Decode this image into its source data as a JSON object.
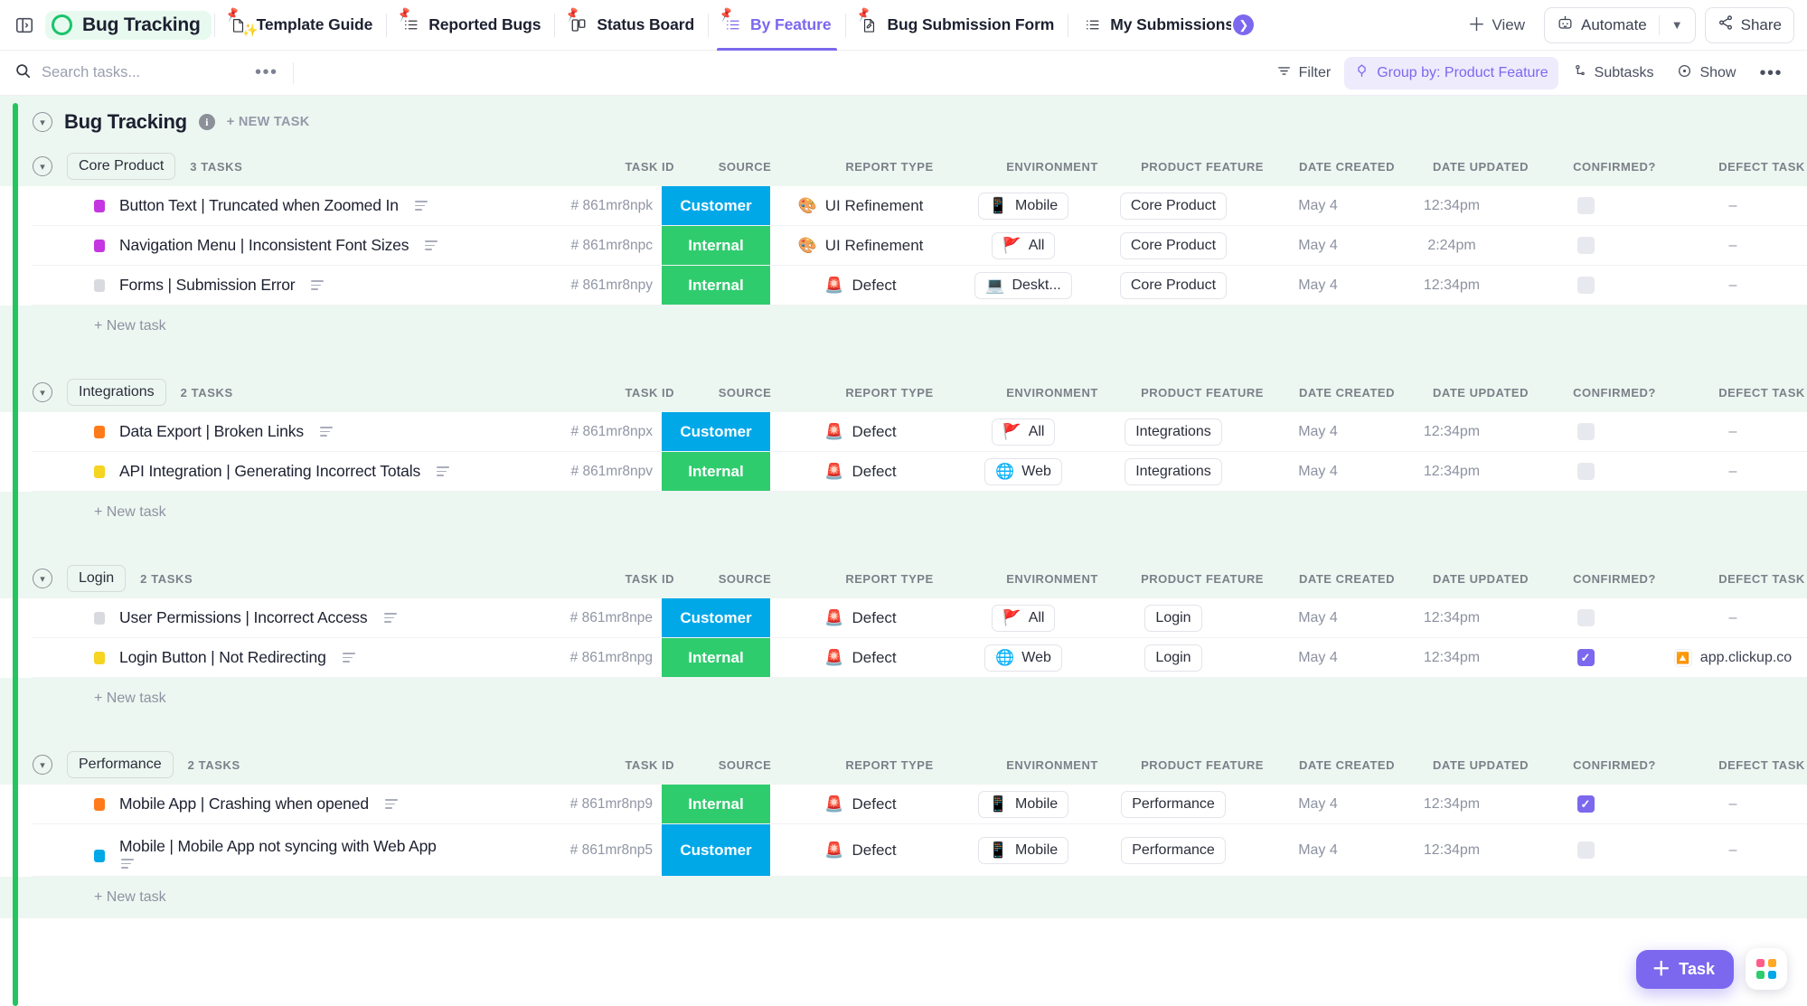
{
  "topnav": {
    "sidebar_toggle_icon": "panel-toggle-icon",
    "list_name": "Bug Tracking",
    "tabs": [
      {
        "label": "Template Guide",
        "icon": "doc-sparkle-icon",
        "active": false,
        "pinned": true,
        "truncated": false
      },
      {
        "label": "Reported Bugs",
        "icon": "list-icon",
        "active": false,
        "pinned": true,
        "truncated": false
      },
      {
        "label": "Status Board",
        "icon": "board-icon",
        "active": false,
        "pinned": true,
        "truncated": false
      },
      {
        "label": "By Feature",
        "icon": "list-icon",
        "active": true,
        "pinned": true,
        "truncated": false
      },
      {
        "label": "Bug Submission Form",
        "icon": "form-icon",
        "active": false,
        "pinned": true,
        "truncated": false
      },
      {
        "label": "My Submissions",
        "icon": "list-icon",
        "active": false,
        "pinned": false,
        "truncated": true
      }
    ],
    "view_button": "View",
    "automate_button": "Automate",
    "share_button": "Share"
  },
  "toolbar": {
    "search_placeholder": "Search tasks...",
    "search_value": "",
    "more_icon": "ellipsis-icon",
    "filter_label": "Filter",
    "group_by_label": "Group by: Product Feature",
    "subtasks_label": "Subtasks",
    "show_label": "Show",
    "overflow_icon": "ellipsis-icon"
  },
  "list_header": {
    "title": "Bug Tracking",
    "info_icon": "info-icon",
    "new_task_label": "+ NEW TASK",
    "accent_color": "#22c55e"
  },
  "columns": [
    "TASK ID",
    "SOURCE",
    "REPORT TYPE",
    "ENVIRONMENT",
    "PRODUCT FEATURE",
    "DATE CREATED",
    "DATE UPDATED",
    "CONFIRMED?",
    "DEFECT TASK"
  ],
  "new_task_row_label": "+ New task",
  "colors": {
    "source_customer": "#00a8e8",
    "source_internal": "#2fcc6e",
    "accent_purple": "#7b68ee",
    "group_band": "#edf7f1"
  },
  "groups": [
    {
      "name": "Core Product",
      "count_label": "3 TASKS",
      "tasks": [
        {
          "status_color": "#c436e0",
          "title": "Button Text | Truncated when Zoomed In",
          "has_description": true,
          "task_id": "# 861mr8npk",
          "source": "Customer",
          "source_type": "customer",
          "report_type": "UI Refinement",
          "report_emoji": "🎨",
          "environment": "Mobile",
          "env_emoji": "📱",
          "product_feature": "Core Product",
          "date_created": "May 4",
          "date_updated": "12:34pm",
          "confirmed": false,
          "defect_task": "–",
          "defect_link": null,
          "tall": false
        },
        {
          "status_color": "#c436e0",
          "title": "Navigation Menu | Inconsistent Font Sizes",
          "has_description": true,
          "task_id": "# 861mr8npc",
          "source": "Internal",
          "source_type": "internal",
          "report_type": "UI Refinement",
          "report_emoji": "🎨",
          "environment": "All",
          "env_emoji": "🚩",
          "product_feature": "Core Product",
          "date_created": "May 4",
          "date_updated": "2:24pm",
          "confirmed": false,
          "defect_task": "–",
          "defect_link": null,
          "tall": false
        },
        {
          "status_color": "#d8dadf",
          "title": "Forms | Submission Error",
          "has_description": true,
          "task_id": "# 861mr8npy",
          "source": "Internal",
          "source_type": "internal",
          "report_type": "Defect",
          "report_emoji": "🚨",
          "environment": "Deskt...",
          "env_emoji": "💻",
          "product_feature": "Core Product",
          "date_created": "May 4",
          "date_updated": "12:34pm",
          "confirmed": false,
          "defect_task": "–",
          "defect_link": null,
          "tall": false
        }
      ]
    },
    {
      "name": "Integrations",
      "count_label": "2 TASKS",
      "tasks": [
        {
          "status_color": "#ff7a1a",
          "title": "Data Export | Broken Links",
          "has_description": true,
          "task_id": "# 861mr8npx",
          "source": "Customer",
          "source_type": "customer",
          "report_type": "Defect",
          "report_emoji": "🚨",
          "environment": "All",
          "env_emoji": "🚩",
          "product_feature": "Integrations",
          "date_created": "May 4",
          "date_updated": "12:34pm",
          "confirmed": false,
          "defect_task": "–",
          "defect_link": null,
          "tall": false
        },
        {
          "status_color": "#f5d422",
          "title": "API Integration | Generating Incorrect Totals",
          "has_description": true,
          "task_id": "# 861mr8npv",
          "source": "Internal",
          "source_type": "internal",
          "report_type": "Defect",
          "report_emoji": "🚨",
          "environment": "Web",
          "env_emoji": "🌐",
          "product_feature": "Integrations",
          "date_created": "May 4",
          "date_updated": "12:34pm",
          "confirmed": false,
          "defect_task": "–",
          "defect_link": null,
          "tall": false
        }
      ]
    },
    {
      "name": "Login",
      "count_label": "2 TASKS",
      "tasks": [
        {
          "status_color": "#d8dadf",
          "title": "User Permissions | Incorrect Access",
          "has_description": true,
          "task_id": "# 861mr8npe",
          "source": "Customer",
          "source_type": "customer",
          "report_type": "Defect",
          "report_emoji": "🚨",
          "environment": "All",
          "env_emoji": "🚩",
          "product_feature": "Login",
          "date_created": "May 4",
          "date_updated": "12:34pm",
          "confirmed": false,
          "defect_task": "–",
          "defect_link": null,
          "tall": false
        },
        {
          "status_color": "#f5d422",
          "title": "Login Button | Not Redirecting",
          "has_description": true,
          "task_id": "# 861mr8npg",
          "source": "Internal",
          "source_type": "internal",
          "report_type": "Defect",
          "report_emoji": "🚨",
          "environment": "Web",
          "env_emoji": "🌐",
          "product_feature": "Login",
          "date_created": "May 4",
          "date_updated": "12:34pm",
          "confirmed": true,
          "defect_task": null,
          "defect_link": "app.clickup.co",
          "tall": false
        }
      ]
    },
    {
      "name": "Performance",
      "count_label": "2 TASKS",
      "tasks": [
        {
          "status_color": "#ff7a1a",
          "title": "Mobile App | Crashing when opened",
          "has_description": true,
          "task_id": "# 861mr8np9",
          "source": "Internal",
          "source_type": "internal",
          "report_type": "Defect",
          "report_emoji": "🚨",
          "environment": "Mobile",
          "env_emoji": "📱",
          "product_feature": "Performance",
          "date_created": "May 4",
          "date_updated": "12:34pm",
          "confirmed": true,
          "defect_task": "–",
          "defect_link": null,
          "tall": false
        },
        {
          "status_color": "#00a8e8",
          "title": "Mobile | Mobile App not syncing with Web App",
          "has_description": true,
          "task_id": "# 861mr8np5",
          "source": "Customer",
          "source_type": "customer",
          "report_type": "Defect",
          "report_emoji": "🚨",
          "environment": "Mobile",
          "env_emoji": "📱",
          "product_feature": "Performance",
          "date_created": "May 4",
          "date_updated": "12:34pm",
          "confirmed": false,
          "defect_task": "–",
          "defect_link": null,
          "tall": true
        }
      ]
    }
  ],
  "fab": {
    "task_label": "Task",
    "plus_icon": "plus-icon",
    "apps_icon": "apps-grid-icon"
  }
}
